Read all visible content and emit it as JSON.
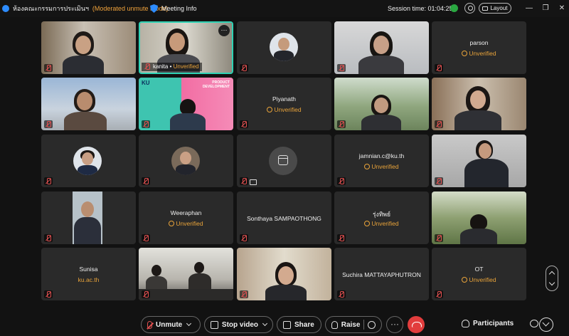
{
  "titlebar": {
    "meeting_title": "ห้องคณะกรรมการประเมินฯ",
    "mode": "(Moderated unmute mode)",
    "meeting_info": "Meeting Info",
    "session": "Session time: 01:04:25",
    "layout": "Layout"
  },
  "unverified_label": "Unverified",
  "tiles": {
    "t1": {},
    "t2": {
      "name": "kanita",
      "separator": " • ",
      "status": "Unverified"
    },
    "t3": {},
    "t4": {},
    "t5": {
      "name": "parson",
      "status": "Unverified"
    },
    "t6": {},
    "t7": {
      "brand": "KU",
      "banner": "PRODUCT DEVELOPMENT"
    },
    "t8": {
      "name": "Piyanath",
      "status": "Unverified"
    },
    "t9": {},
    "t10": {},
    "t11": {},
    "t12": {},
    "t13": {},
    "t14": {
      "name": "jamnian.c@ku.th",
      "status": "Unverified"
    },
    "t15": {},
    "t16": {},
    "t17": {
      "name": "Weeraphan",
      "status": "Unverified"
    },
    "t18": {
      "name": "Sonthaya SAMPAOTHONG"
    },
    "t19": {
      "name": "รุ่งทิพย์",
      "status": "Unverified"
    },
    "t20": {},
    "t21": {
      "name": "Sunisa",
      "subtitle": "ku.ac.th"
    },
    "t22": {},
    "t23": {},
    "t24": {
      "name": "Suchira MATTAYAPHUTRON"
    },
    "t25": {
      "name": "OT",
      "status": "Unverified"
    }
  },
  "toolbar": {
    "unmute": "Unmute",
    "stop_video": "Stop video",
    "share": "Share",
    "raise": "Raise",
    "more": "···",
    "participants": "Participants"
  },
  "colors": {
    "accent": "#2fd2b4",
    "warning": "#e8a33a",
    "muted_red": "#e05050",
    "leave_red": "#e23d3d",
    "tile_bg": "#2a2a2a"
  }
}
